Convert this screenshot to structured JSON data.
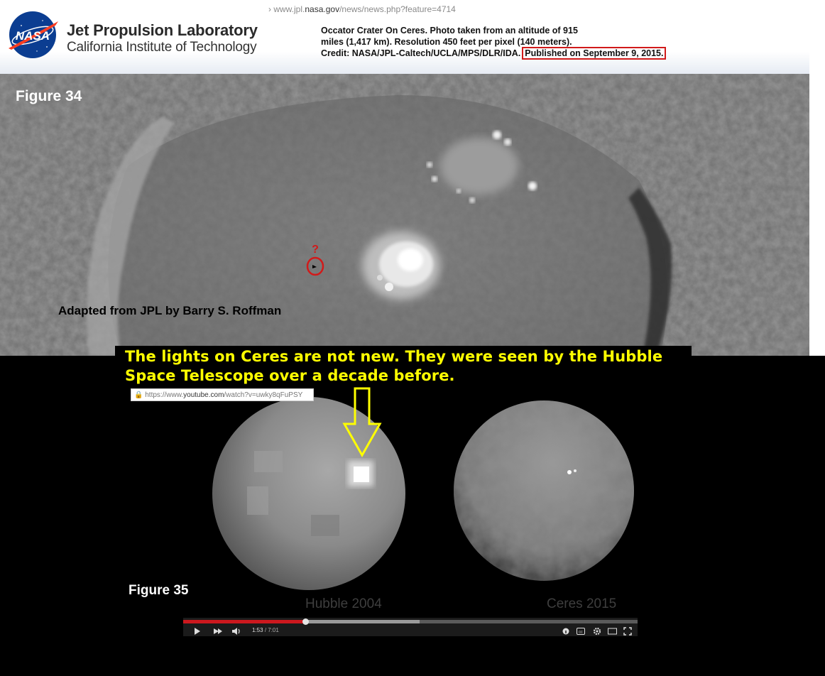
{
  "header": {
    "url_prefix": "www.jpl.",
    "url_domain": "nasa.gov",
    "url_suffix": "/news/news.php?feature=4714",
    "logo_text": "NASA",
    "title": "Jet Propulsion Laboratory",
    "subtitle": "California Institute of Technology",
    "caption_line1": "Occator Crater On Ceres. Photo taken from an altitude of 915",
    "caption_line2": "miles (1,417 km). Resolution 450  feet  per pixel (140 meters).",
    "caption_line3": "Credit: NASA/JPL-Caltech/UCLA/MPS/DLR/IDA.",
    "published": "Published on September 9, 2015."
  },
  "figure34": {
    "label": "Figure 34",
    "question_mark": "?",
    "credit": "Adapted from JPL by Barry S. Roffman"
  },
  "figure35": {
    "banner_text": "The lights on Ceres are not new. They were seen by the Hubble Space Telescope over a decade before.",
    "yt_url_prefix": "https://www.",
    "yt_url_domain": "youtube.com",
    "yt_url_suffix": "/watch?v=uwky8qFuPSY",
    "hubble_caption": "Hubble 2004",
    "ceres_caption": "Ceres 2015",
    "label": "Figure 35"
  },
  "player": {
    "current_time": "1:53",
    "duration": "/ 7:01",
    "progress_played": 0.27,
    "progress_loaded": 0.52,
    "icons": [
      "play-icon",
      "next-icon",
      "volume-icon",
      "info-icon",
      "captions-icon",
      "settings-icon",
      "theater-icon",
      "fullscreen-icon"
    ]
  },
  "colors": {
    "banner_text": "#ffff00",
    "highlight_box": "#d11a1a",
    "progress": "#cc181e",
    "arrow": "#ffff00"
  }
}
